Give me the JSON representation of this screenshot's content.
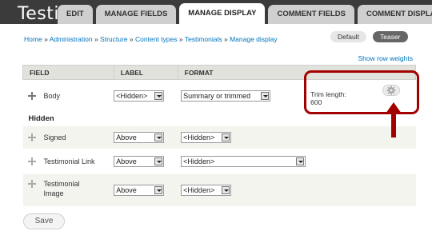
{
  "header": {
    "title_fragment": "Testimo",
    "tabs": [
      {
        "label": "EDIT",
        "active": false
      },
      {
        "label": "MANAGE FIELDS",
        "active": false
      },
      {
        "label": "MANAGE DISPLAY",
        "active": true
      },
      {
        "label": "COMMENT FIELDS",
        "active": false
      },
      {
        "label": "COMMENT DISPLAY",
        "active": false
      }
    ]
  },
  "breadcrumb": {
    "items": [
      "Home",
      "Administration",
      "Structure",
      "Content types",
      "Testimonials",
      "Manage display"
    ],
    "separator": "»"
  },
  "view_modes": {
    "default_label": "Default",
    "teaser_label": "Teaser",
    "selected": "Teaser"
  },
  "show_row_weights": "Show row weights",
  "table": {
    "headers": {
      "field": "FIELD",
      "label": "LABEL",
      "format": "FORMAT"
    },
    "hidden_heading": "Hidden",
    "rows": [
      {
        "field": "Body",
        "label": "<Hidden>",
        "format": "Summary or trimmed",
        "settings_label": "Trim length:",
        "settings_value": "600"
      },
      {
        "field": "Signed",
        "label": "Above",
        "format": "<Hidden>"
      },
      {
        "field": "Testimonial Link",
        "label": "Above",
        "format": "<Hidden>"
      },
      {
        "field": "Testimonial Image",
        "label": "Above",
        "format": "<Hidden>"
      }
    ]
  },
  "save_label": "Save",
  "colors": {
    "header_bg": "#3b3b3b",
    "link": "#0074bd",
    "annotation": "#a30000",
    "active_view_bg": "#666666"
  },
  "icons": {
    "gear": "gear-icon",
    "drag": "drag-handle-icon",
    "annotation_arrow": "arrow-up-icon"
  }
}
